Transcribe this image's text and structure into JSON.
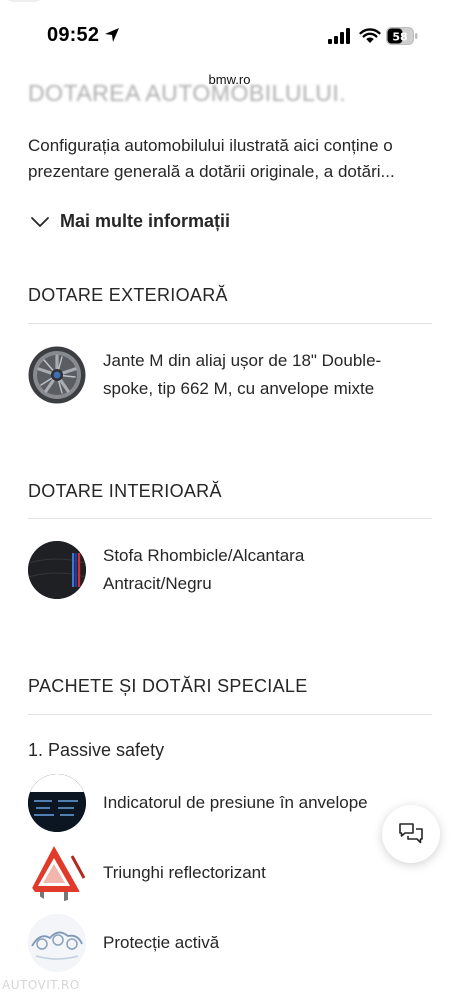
{
  "status_bar": {
    "time": "09:52",
    "battery_level": "58",
    "icons": [
      "location-arrow-icon",
      "cellular-signal-icon",
      "wifi-icon",
      "battery-icon"
    ]
  },
  "browser": {
    "url": "bmw.ro"
  },
  "intro": {
    "heading": "DOTAREA AUTOMOBILULUI.",
    "description_line1": "Configurația automobilului ilustrată aici conține o",
    "description_line2": "prezentare generală a dotării originale, a dotări...",
    "more_info_label": "Mai multe informații"
  },
  "exterior": {
    "title": "DOTARE EXTERIOARĂ",
    "item_line1": "Jante M din aliaj ușor de 18\" Double-",
    "item_line2": "spoke, tip 662 M, cu anvelope mixte"
  },
  "interior": {
    "title": "DOTARE INTERIOARĂ",
    "item_line1": "Stofa Rhombicle/Alcantara",
    "item_line2": "Antracit/Negru"
  },
  "packages": {
    "title": "PACHETE ȘI DOTĂRI SPECIALE",
    "group_title": "1. Passive safety",
    "items": [
      {
        "label": "Indicatorul de presiune în anvelope",
        "icon": "tire-pressure-thumbnail"
      },
      {
        "label": "Triunghi reflectorizant",
        "icon": "warning-triangle-thumbnail"
      },
      {
        "label": "Protecție activă",
        "icon": "active-protection-thumbnail"
      }
    ]
  },
  "chat_button": {
    "icon": "chat-bubbles-icon"
  },
  "watermark": "AUTOVIT.RO"
}
